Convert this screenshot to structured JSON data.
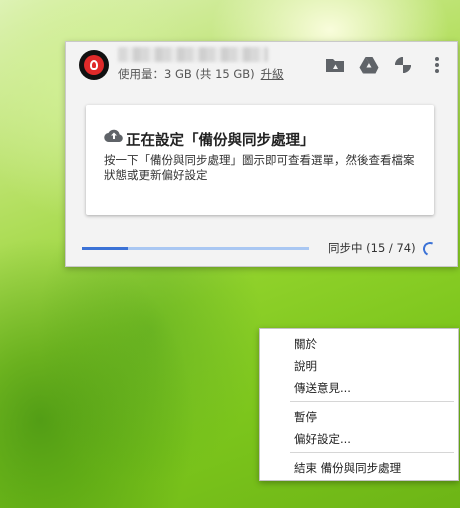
{
  "header": {
    "usage_text": "使用量：3 GB (共 15 GB)",
    "upgrade_label": "升級"
  },
  "card": {
    "title": "正在設定「備份與同步處理」",
    "description": "按一下「備份與同步處理」圖示即可查看選單，然後查看檔案狀態或更新偏好設定"
  },
  "sync": {
    "status_text": "同步中 (15 / 74)",
    "done": 15,
    "total": 74
  },
  "menu": {
    "about": "關於",
    "help": "說明",
    "feedback": "傳送意見...",
    "pause": "暫停",
    "preferences": "偏好設定...",
    "quit": "結束 備份與同步處理"
  },
  "colors": {
    "accent": "#3b72d6",
    "avatar_red": "#e02a2a"
  }
}
